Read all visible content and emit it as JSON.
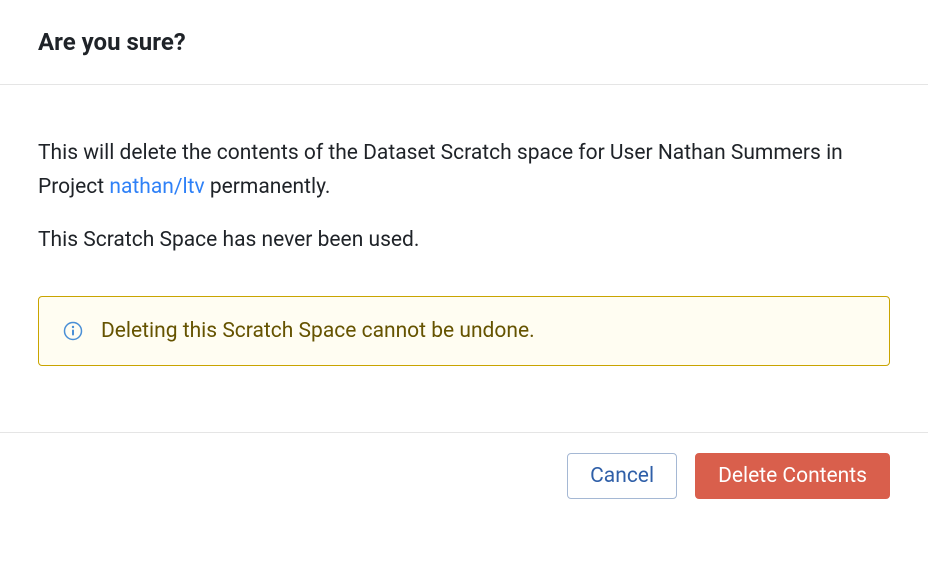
{
  "dialog": {
    "title": "Are you sure?",
    "body": {
      "text_prefix": "This will delete the contents of the Dataset Scratch space for User Nathan Summers in Project ",
      "project_link": "nathan/ltv",
      "text_suffix": " permanently.",
      "usage_text": "This Scratch Space has never been used."
    },
    "alert": {
      "message": "Deleting this Scratch Space cannot be undone."
    },
    "footer": {
      "cancel_label": "Cancel",
      "confirm_label": "Delete Contents"
    }
  }
}
